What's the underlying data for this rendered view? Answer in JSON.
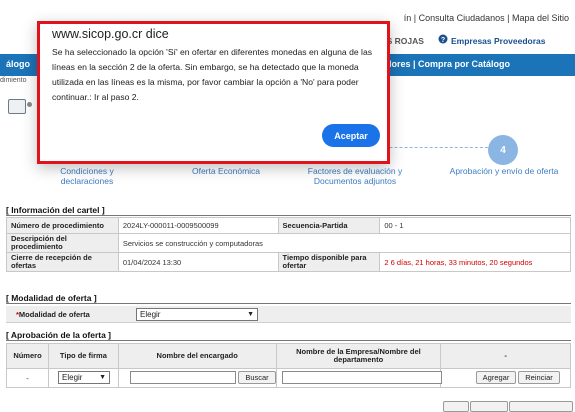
{
  "top_links": {
    "text": "ín | Consulta Ciudadanos | Mapa del Sitio"
  },
  "subnav": {
    "partial_left": "OS ROJAS",
    "proveedores": "Empresas Proveedoras",
    "proveedores_icon": "question-circle-icon"
  },
  "navbar": {
    "left_label": "álogo",
    "right_label": "dores | Compra por Catálogo",
    "color": "#1b73b8"
  },
  "breadcrumb": "dimiento",
  "wizard": {
    "active_step": "4",
    "steps": [
      {
        "label": "Condiciones y declaraciones"
      },
      {
        "label": "Oferta Económica"
      },
      {
        "label": "Factores de evaluación y Documentos adjuntos"
      },
      {
        "label": "Aprobación y envío de oferta"
      }
    ]
  },
  "informacion": {
    "title": "[ Información del cartel ]",
    "numero_label": "Número de procedimiento",
    "numero_value": "2024LY-000011-0009500099",
    "secuencia_label": "Secuencia-Partida",
    "secuencia_value": "00 - 1",
    "descripcion_label": "Descripción del procedimiento",
    "descripcion_value": "Servicios se construcción y computadoras",
    "cierre_label": "Cierre de recepción de ofertas",
    "cierre_value": "01/04/2024 13:30",
    "tiempo_label": "Tiempo disponible para ofertar",
    "tiempo_value": "2 6 días, 21 horas, 33 minutos, 20 segundos"
  },
  "modalidad": {
    "title": "[ Modalidad de oferta ]",
    "label": "Modalidad de oferta",
    "required_mark": "*",
    "selected": "Elegir"
  },
  "aprobacion": {
    "title": "[ Aprobación de la oferta ]",
    "headers": [
      "Número",
      "Tipo de firma",
      "Nombre del encargado",
      "Nombre de la Empresa/Nombre del departamento",
      "-"
    ],
    "row": {
      "numero": "-",
      "tipo_firma": "Elegir",
      "buscar": "Buscar",
      "agregar": "Agregar",
      "reiniciar": "Reinciar"
    }
  },
  "dialog": {
    "title": "www.sicop.go.cr dice",
    "message": "Se ha seleccionado la opción 'Sí' en ofertar en diferentes monedas en alguna de las líneas en la sección 2 de la oferta. Sin embargo, se ha detectado que la moneda utilizada en las líneas es la misma, por favor cambiar la opción a 'No' para poder continuar.: Ir al paso 2.",
    "ok_label": "Aceptar",
    "ok_color": "#1a73e8",
    "highlight_color": "#e0121b"
  }
}
